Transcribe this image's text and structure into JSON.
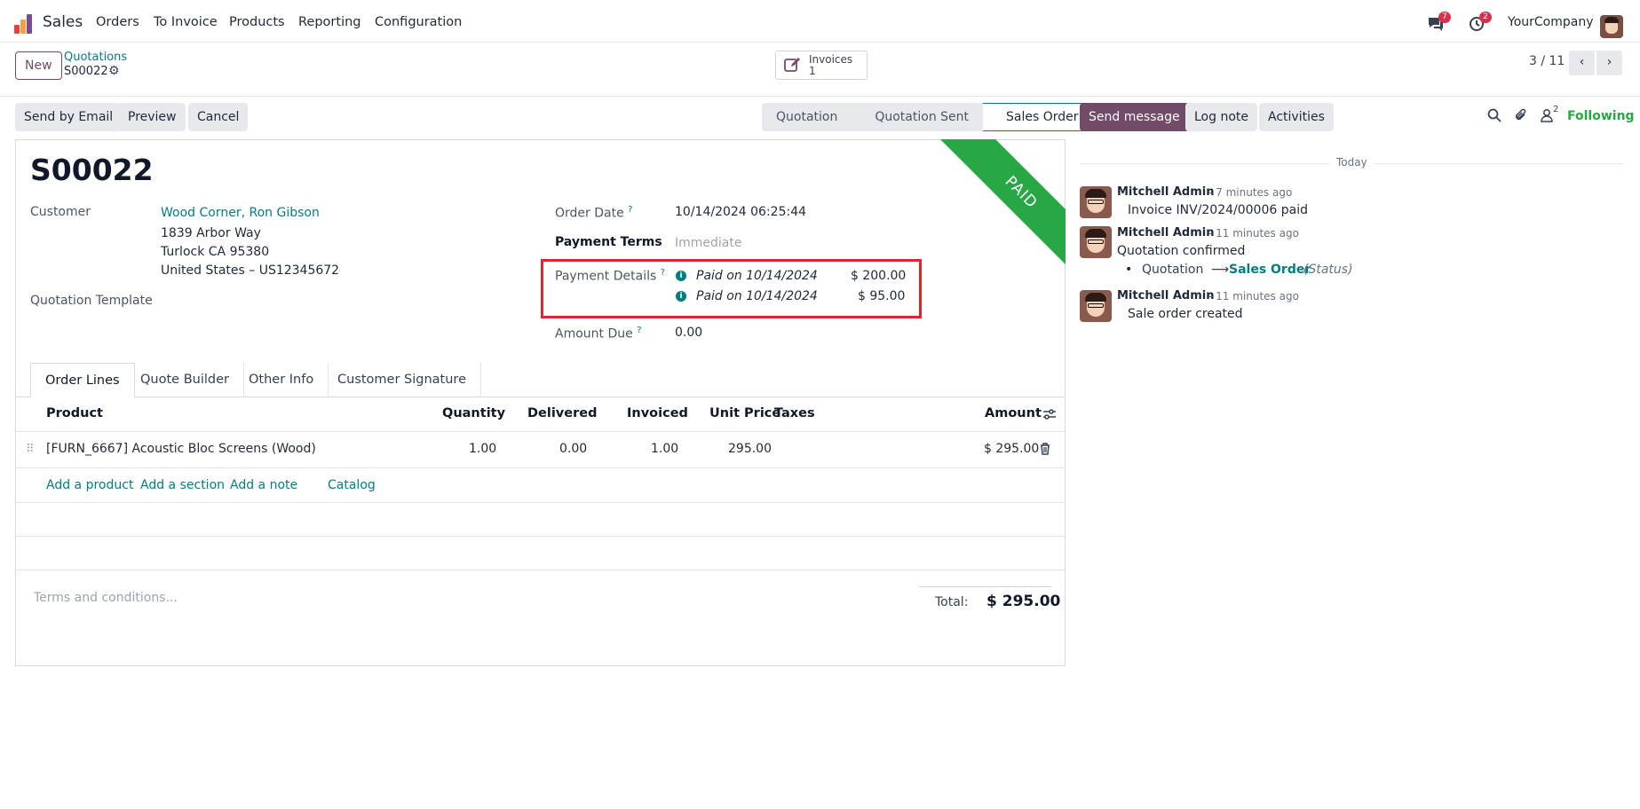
{
  "nav": {
    "app_name": "Sales",
    "menu": [
      "Orders",
      "To Invoice",
      "Products",
      "Reporting",
      "Configuration"
    ],
    "messages_badge": "7",
    "activities_badge": "2",
    "company": "YourCompany"
  },
  "control": {
    "new_label": "New",
    "breadcrumb_parent": "Quotations",
    "record_name": "S00022",
    "smart_button_label": "Invoices",
    "smart_button_count": "1",
    "pager": "3 / 11"
  },
  "actions": {
    "send_email": "Send by Email",
    "preview": "Preview",
    "cancel": "Cancel"
  },
  "statusbar": [
    "Quotation",
    "Quotation Sent",
    "Sales Order"
  ],
  "chatter_actions": {
    "send_message": "Send message",
    "log_note": "Log note",
    "activities": "Activities",
    "followers_count": "2",
    "following": "Following"
  },
  "form": {
    "title": "S00022",
    "ribbon": "PAID",
    "customer_label": "Customer",
    "customer_name": "Wood Corner, Ron Gibson",
    "address_1": "1839 Arbor Way",
    "address_2": "Turlock CA 95380",
    "address_3": "United States – US12345672",
    "template_label": "Quotation Template",
    "order_date_label": "Order Date",
    "order_date": "10/14/2024 06:25:44",
    "payment_terms_label": "Payment Terms",
    "payment_terms": "Immediate",
    "payment_details_label": "Payment Details",
    "payments": [
      {
        "label": "Paid on 10/14/2024",
        "amount": "$ 200.00"
      },
      {
        "label": "Paid on 10/14/2024",
        "amount": "$ 95.00"
      }
    ],
    "amount_due_label": "Amount Due",
    "amount_due": "0.00",
    "help_mark": "?",
    "info_mark": "i"
  },
  "tabs": [
    "Order Lines",
    "Quote Builder",
    "Other Info",
    "Customer Signature"
  ],
  "table": {
    "headers": {
      "product": "Product",
      "quantity": "Quantity",
      "delivered": "Delivered",
      "invoiced": "Invoiced",
      "unit_price": "Unit Price",
      "taxes": "Taxes",
      "amount": "Amount"
    },
    "rows": [
      {
        "product": "[FURN_6667] Acoustic Bloc Screens (Wood)",
        "quantity": "1.00",
        "delivered": "0.00",
        "invoiced": "1.00",
        "unit_price": "295.00",
        "taxes": "",
        "amount": "$ 295.00"
      }
    ],
    "add_product": "Add a product",
    "add_section": "Add a section",
    "add_note": "Add a note",
    "catalog": "Catalog"
  },
  "footer": {
    "terms_placeholder": "Terms and conditions...",
    "total_label": "Total:",
    "total_value": "$ 295.00"
  },
  "chatter": {
    "date_separator": "Today",
    "messages": [
      {
        "author": "Mitchell Admin",
        "time": "- 7 minutes ago",
        "body": "Invoice INV/2024/00006 paid"
      },
      {
        "author": "Mitchell Admin",
        "time": "- 11 minutes ago",
        "body": "Quotation confirmed",
        "change_from": "Quotation",
        "change_arrow": "⟶",
        "change_to": "Sales Order",
        "change_field": "(Status)"
      },
      {
        "author": "Mitchell Admin",
        "time": "- 11 minutes ago",
        "body": "Sale order created"
      }
    ]
  },
  "colors": {
    "primary": "#714b67",
    "link": "#017e84",
    "ribbon": "#28a745",
    "highlight_box": "#e0252b",
    "badge": "#d9304b"
  }
}
